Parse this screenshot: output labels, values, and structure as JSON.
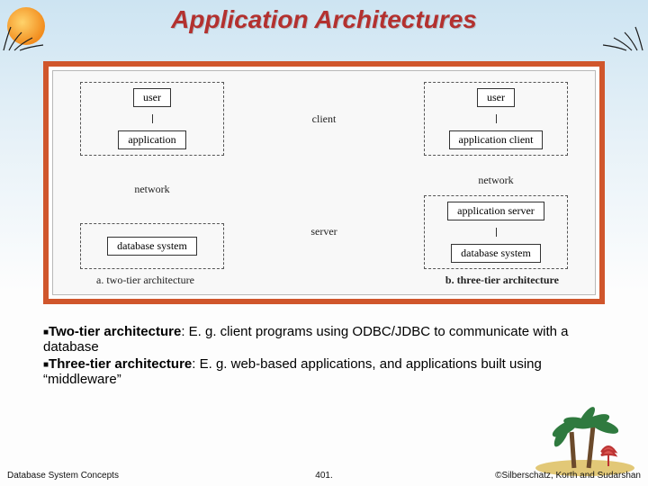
{
  "title": "Application Architectures",
  "diagram": {
    "left": {
      "user": "user",
      "app": "application",
      "network": "network",
      "db": "database system",
      "caption": "a.   two-tier architecture"
    },
    "right": {
      "user": "user",
      "appclient": "application client",
      "network": "network",
      "appserver": "application server",
      "db": "database system",
      "caption": "b.   three-tier architecture"
    },
    "mid": {
      "client": "client",
      "server": "server"
    }
  },
  "bullets": {
    "b1_bold": "Two-tier architecture",
    "b1_rest": ":  E. g. client programs using ODBC/JDBC to communicate with a database",
    "b2_bold": "Three-tier architecture",
    "b2_rest": ": E. g. web-based applications, and applications built using “middleware”"
  },
  "footer": {
    "left": "Database System Concepts",
    "center": "401.",
    "right": "©Silberschatz, Korth and Sudarshan"
  }
}
